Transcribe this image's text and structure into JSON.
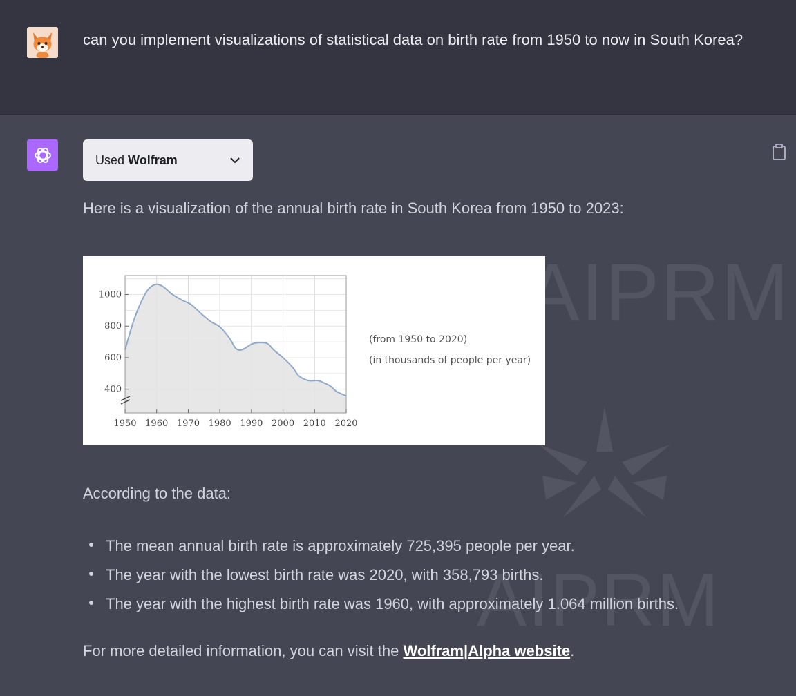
{
  "user": {
    "message": "can you implement visualizations of statistical data on birth rate from 1950 to now in South Korea?"
  },
  "assistant": {
    "used_prefix": "Used",
    "used_tool": "Wolfram",
    "intro": "Here is a visualization of the annual birth rate in South Korea from 1950 to 2023:",
    "according": "According to the data:",
    "bullets": [
      "The mean annual birth rate is approximately 725,395 people per year.",
      "The year with the lowest birth rate was 2020, with 358,793 births.",
      "The year with the highest birth rate was 1960, with approximately 1.064 million births."
    ],
    "more_prefix": "For more detailed information, you can visit the ",
    "more_link": "Wolfram|Alpha website",
    "more_suffix": "."
  },
  "watermark": {
    "text": "AIPRM"
  },
  "colors": {
    "user_bg": "#343541",
    "assistant_bg": "#444654",
    "bot_avatar": "#ab68ff",
    "line": "#8fa9c9",
    "area": "#e4e4e4"
  },
  "chart_data": {
    "type": "area",
    "x": [
      1950,
      1953,
      1956,
      1958,
      1960,
      1962,
      1965,
      1968,
      1971,
      1974,
      1977,
      1980,
      1983,
      1985,
      1987,
      1990,
      1992,
      1995,
      1997,
      2000,
      2003,
      2005,
      2008,
      2011,
      2013,
      2015,
      2017,
      2020
    ],
    "values": [
      650,
      850,
      990,
      1045,
      1064,
      1050,
      1000,
      965,
      935,
      880,
      830,
      795,
      725,
      660,
      650,
      685,
      695,
      690,
      650,
      600,
      540,
      485,
      455,
      455,
      440,
      420,
      385,
      358
    ],
    "xticks": [
      1950,
      1960,
      1970,
      1980,
      1990,
      2000,
      2010,
      2020
    ],
    "yticks": [
      400,
      600,
      800,
      1000
    ],
    "xlim": [
      1950,
      2020
    ],
    "ylim": [
      250,
      1120
    ],
    "grid": true,
    "axis_break": true,
    "notes": [
      "(from 1950 to 2020)",
      "(in thousands of people per year)"
    ]
  }
}
